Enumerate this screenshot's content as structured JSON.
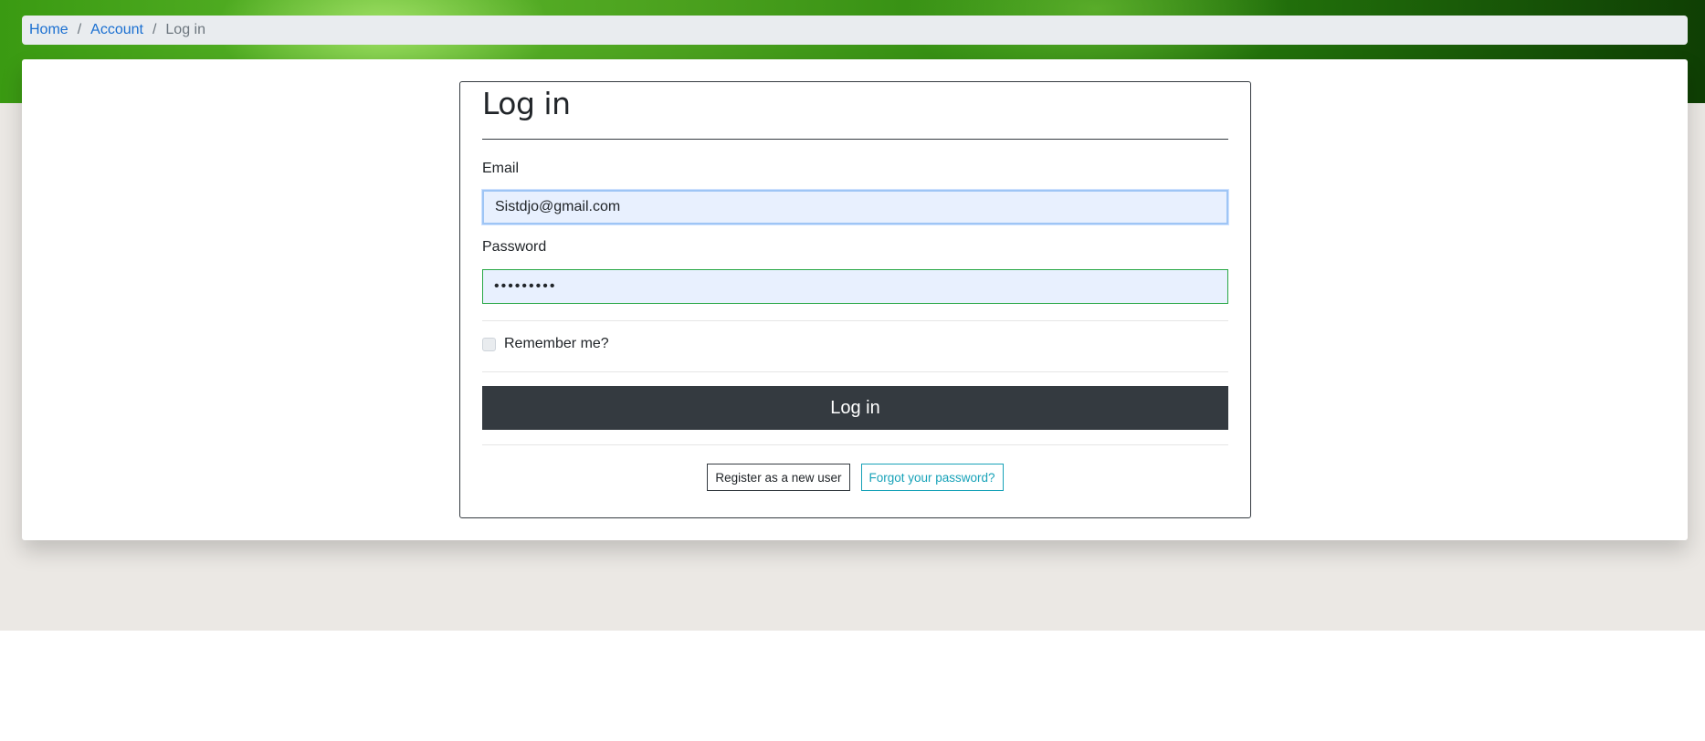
{
  "breadcrumb": {
    "items": [
      {
        "label": "Home"
      },
      {
        "label": "Account"
      }
    ],
    "separator": "/",
    "current": "Log in"
  },
  "login": {
    "title": "Log in",
    "email_label": "Email",
    "email_value": "Sistdjo@gmail.com",
    "password_label": "Password",
    "password_value": "•••••••••",
    "remember_label": "Remember me?",
    "remember_checked": false,
    "submit_label": "Log in",
    "register_label": "Register as a new user",
    "forgot_label": "Forgot your password?"
  },
  "colors": {
    "accent_dark": "#343a40",
    "link_blue": "#1a6fd1",
    "info_teal": "#17a2b8",
    "valid_green": "#28a745",
    "autofill_bg": "#e8f0fe"
  }
}
